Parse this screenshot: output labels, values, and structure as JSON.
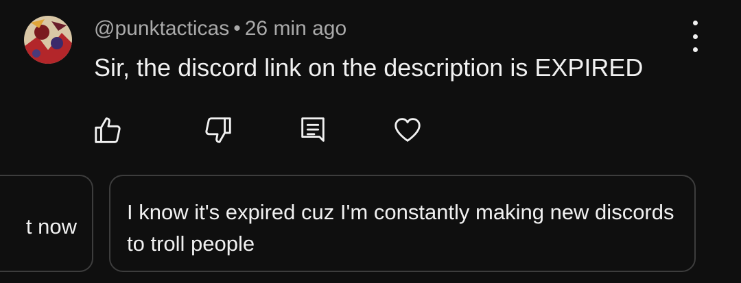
{
  "comment": {
    "author": "@punktacticas",
    "separator": "•",
    "time": "26 min ago",
    "text": "Sir, the discord link on the description is EXPIRED"
  },
  "actions": [
    "like-icon",
    "dislike-icon",
    "reply-icon",
    "heart-icon"
  ],
  "suggested_replies": [
    {
      "text": "t now"
    },
    {
      "text": "I know it's expired cuz I'm constantly making new discords to troll people"
    }
  ],
  "colors": {
    "background": "#0f0f0f",
    "text": "#f1f1f1",
    "meta_text": "#aaaaaa",
    "card_border": "#3d3d3d"
  }
}
